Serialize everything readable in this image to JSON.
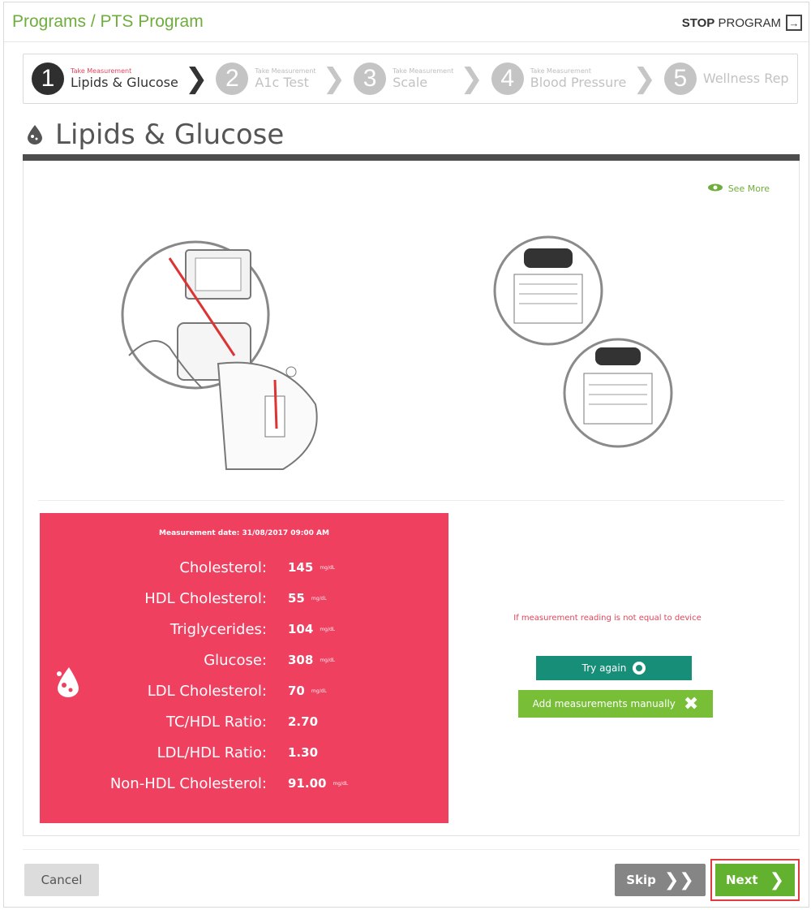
{
  "header": {
    "breadcrumb": "Programs / PTS Program",
    "stop_strong": "STOP",
    "stop_rest": "PROGRAM"
  },
  "steps": [
    {
      "number": "1",
      "sub": "Take Measurement",
      "label": "Lipids & Glucose",
      "active": true
    },
    {
      "number": "2",
      "sub": "Take Measurement",
      "label": "A1c Test",
      "active": false
    },
    {
      "number": "3",
      "sub": "Take Measurement",
      "label": "Scale",
      "active": false
    },
    {
      "number": "4",
      "sub": "Take Measurement",
      "label": "Blood Pressure",
      "active": false
    },
    {
      "number": "5",
      "sub": "",
      "label": "Wellness Rep",
      "active": false
    }
  ],
  "page": {
    "title": "Lipids & Glucose",
    "see_more": "See More"
  },
  "results": {
    "measurement_date": "Measurement date: 31/08/2017 09:00 AM",
    "rows": [
      {
        "label": "Cholesterol:",
        "value": "145",
        "unit": "mg/dL"
      },
      {
        "label": "HDL Cholesterol:",
        "value": "55",
        "unit": "mg/dL"
      },
      {
        "label": "Triglycerides:",
        "value": "104",
        "unit": "mg/dL"
      },
      {
        "label": "Glucose:",
        "value": "308",
        "unit": "mg/dL"
      },
      {
        "label": "LDL Cholesterol:",
        "value": "70",
        "unit": "mg/dL"
      },
      {
        "label": "TC/HDL Ratio:",
        "value": "2.70",
        "unit": ""
      },
      {
        "label": "LDL/HDL Ratio:",
        "value": "1.30",
        "unit": ""
      },
      {
        "label": "Non-HDL Cholesterol:",
        "value": "91.00",
        "unit": "mg/dL"
      }
    ]
  },
  "actions": {
    "note": "If measurement reading is not equal to device",
    "try_again": "Try again",
    "add_manually": "Add measurements manually"
  },
  "footer": {
    "cancel": "Cancel",
    "skip": "Skip",
    "next": "Next"
  },
  "colors": {
    "brand_green": "#6fae3c",
    "result_red": "#f04060",
    "try_teal": "#178f78",
    "add_green": "#78bf37",
    "next_green": "#63b22f",
    "highlight_red": "#e23b3b"
  }
}
